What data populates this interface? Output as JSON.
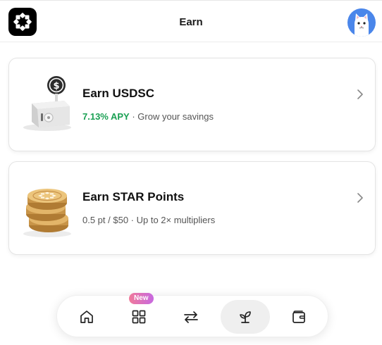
{
  "header": {
    "title": "Earn",
    "logo_icon": "star-logo-icon",
    "avatar_icon": "cat-avatar-icon"
  },
  "cards": [
    {
      "title": "Earn USDSC",
      "apy": "7.13% APY",
      "separator": " · ",
      "subtitle": "Grow your savings",
      "art_icon": "safe-with-dollar-coin-icon"
    },
    {
      "title": "Earn STAR Points",
      "subtitle": "0.5 pt / $50 · Up to 2× multipliers",
      "art_icon": "coin-stack-icon"
    }
  ],
  "nav": {
    "new_badge": "New",
    "items": [
      {
        "icon": "home-icon"
      },
      {
        "icon": "grid-icon"
      },
      {
        "icon": "swap-icon"
      },
      {
        "icon": "sprout-icon",
        "active": true
      },
      {
        "icon": "wallet-icon"
      }
    ]
  },
  "colors": {
    "apy_green": "#1aa053",
    "avatar_blue": "#4a86ea",
    "badge_gradient_start": "#f07a9a",
    "badge_gradient_end": "#c768e0",
    "active_nav_bg": "#efefef"
  }
}
